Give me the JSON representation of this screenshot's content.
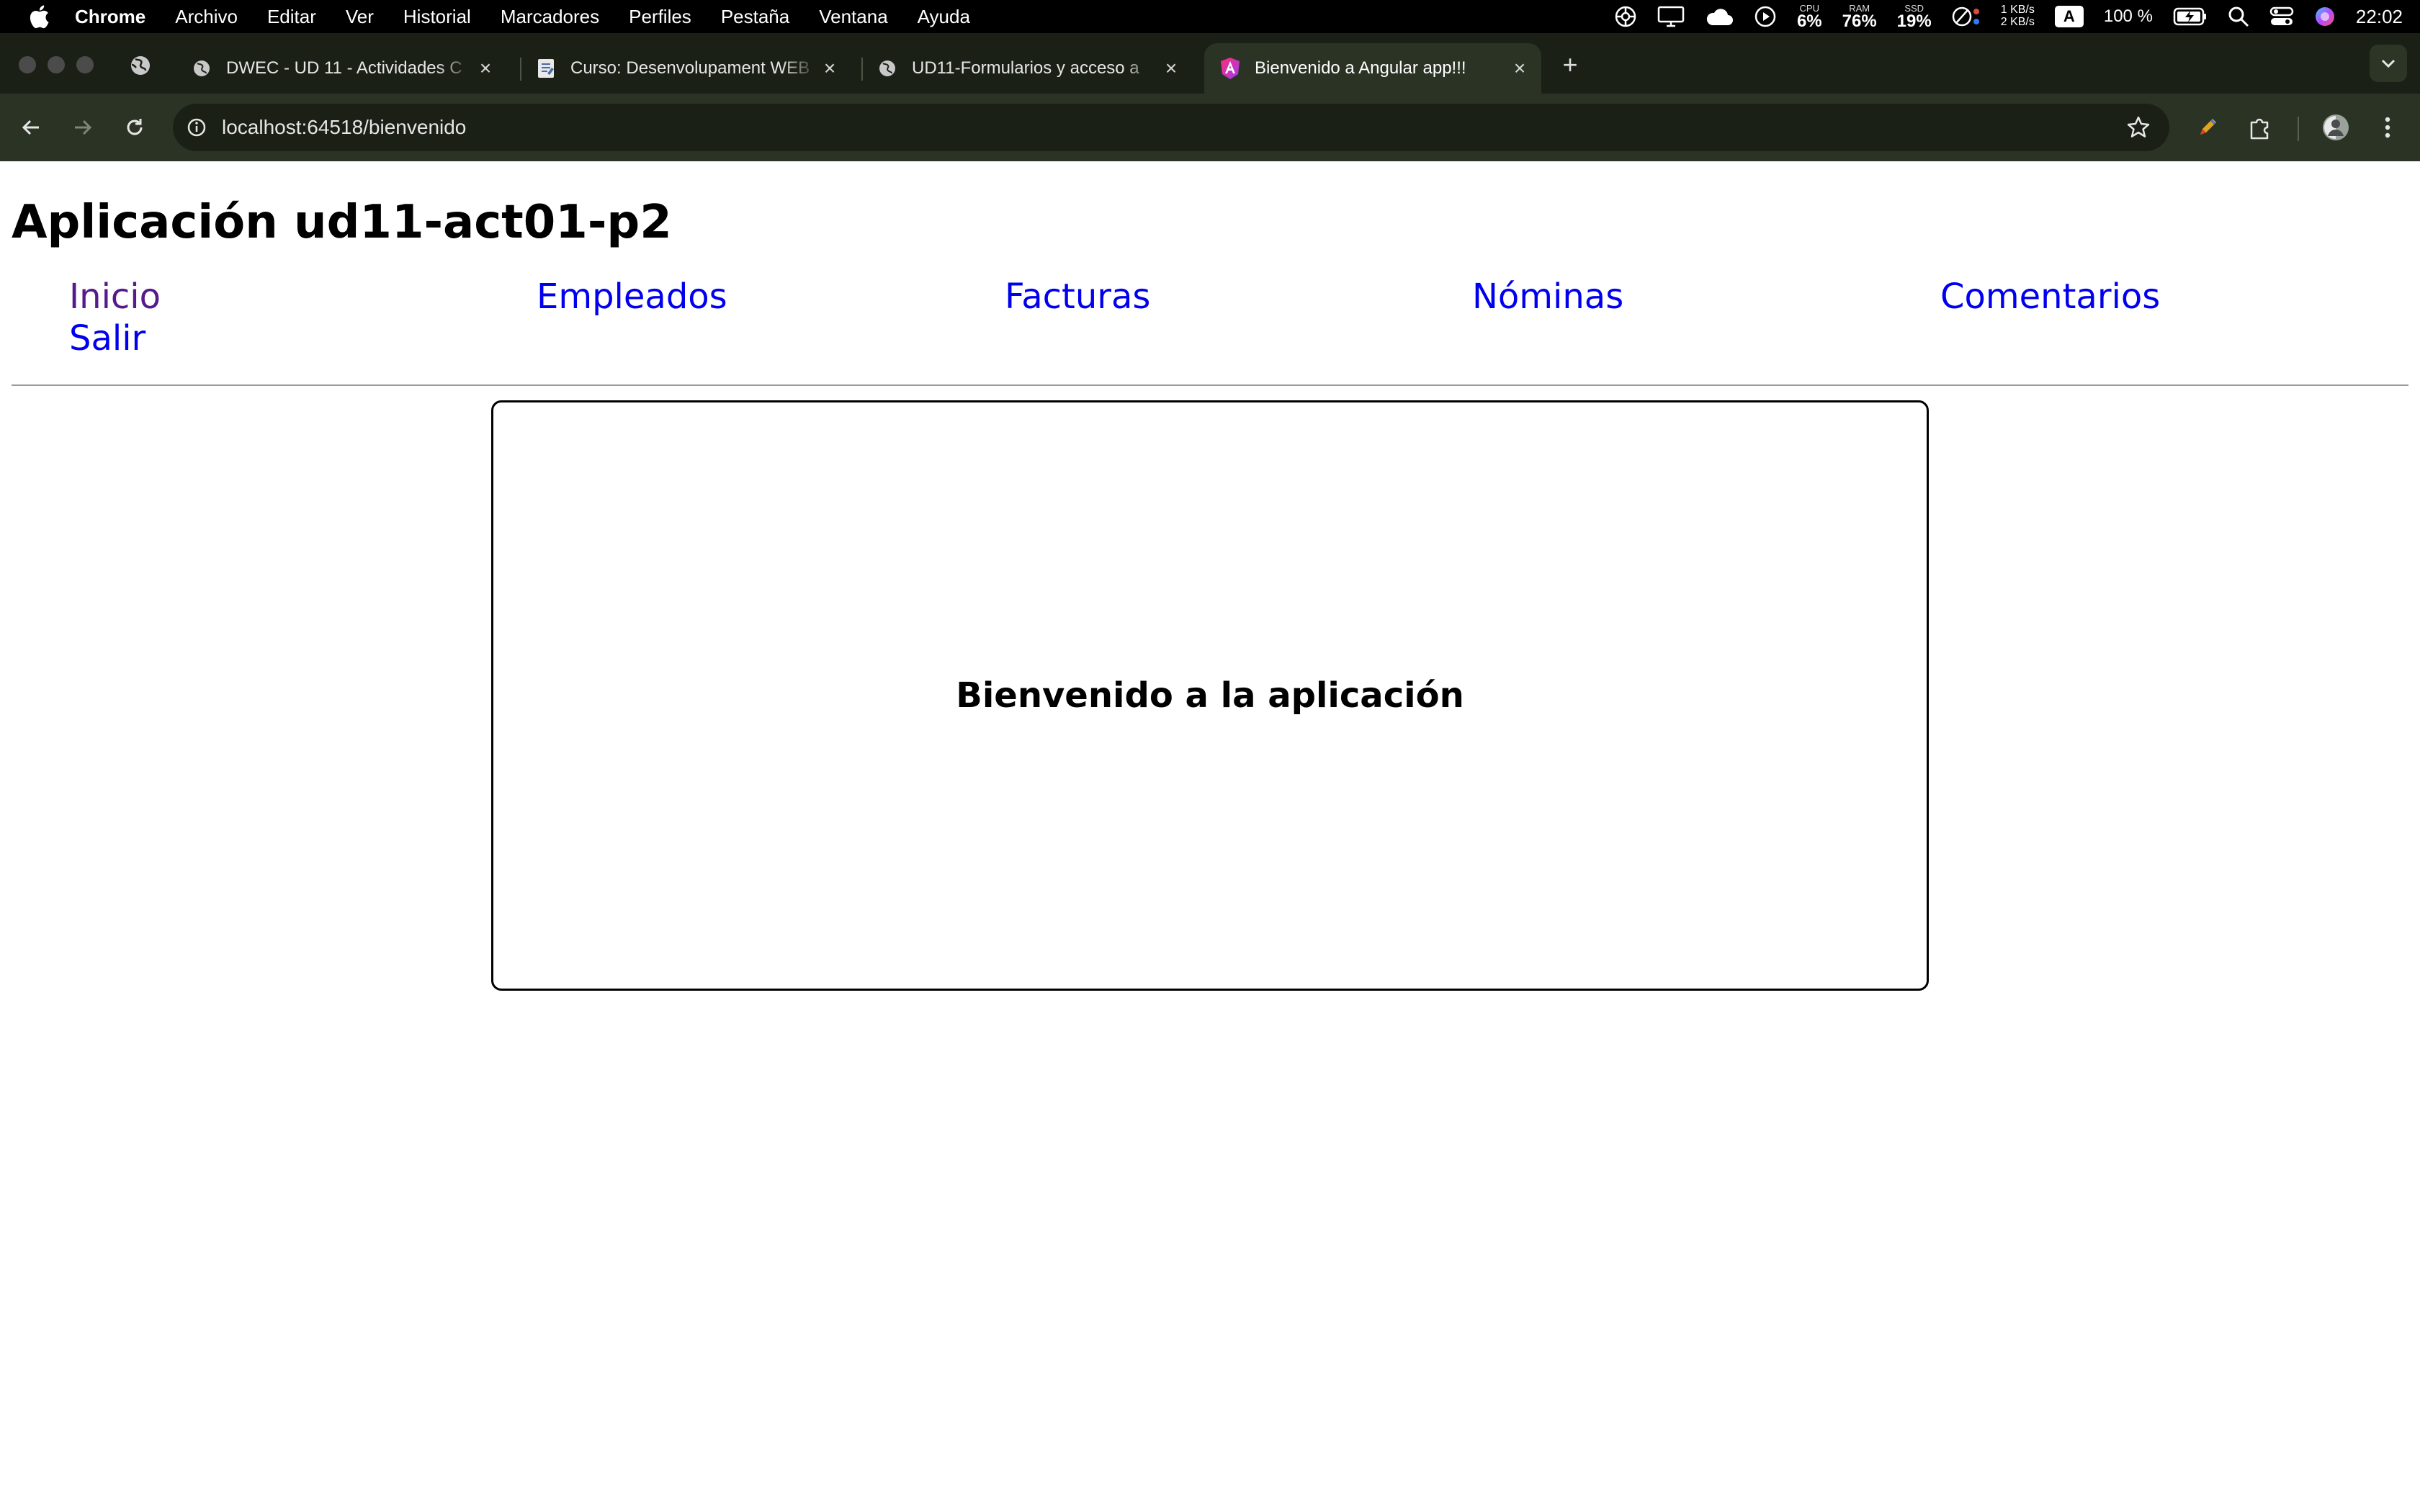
{
  "menubar": {
    "app_name": "Chrome",
    "menu_items": [
      "Archivo",
      "Editar",
      "Ver",
      "Historial",
      "Marcadores",
      "Perfiles",
      "Pestaña",
      "Ventana",
      "Ayuda"
    ],
    "stats": {
      "cpu_label": "CPU",
      "cpu_value": "6%",
      "ram_label": "RAM",
      "ram_value": "76%",
      "ssd_label": "SSD",
      "ssd_value": "19%",
      "net_up": "1 KB/s",
      "net_down": "2 KB/s"
    },
    "input_source": "A",
    "battery": "100 %",
    "clock": "22:02"
  },
  "tabs": [
    {
      "title": "DWEC - UD 11 - Actividades C",
      "icon": "globe-icon",
      "active": false
    },
    {
      "title": "Curso: Desenvolupament WEB",
      "icon": "document-icon",
      "active": false
    },
    {
      "title": "UD11-Formularios y acceso a",
      "icon": "globe-icon",
      "active": false
    },
    {
      "title": "Bienvenido a Angular app!!!",
      "icon": "angular-icon",
      "active": true
    }
  ],
  "toolbar": {
    "url": "localhost:64518/bienvenido"
  },
  "page": {
    "app_title": "Aplicación ud11-act01-p2",
    "nav": {
      "inicio": "Inicio",
      "empleados": "Empleados",
      "facturas": "Facturas",
      "nominas": "Nóminas",
      "comentarios": "Comentarios",
      "salir": "Salir"
    },
    "welcome": "Bienvenido a la aplicación"
  },
  "colors": {
    "link": "#0000ee",
    "visited_link": "#551a8b",
    "tabstrip_bg": "#1b2016",
    "toolbar_bg": "#2b3325"
  }
}
